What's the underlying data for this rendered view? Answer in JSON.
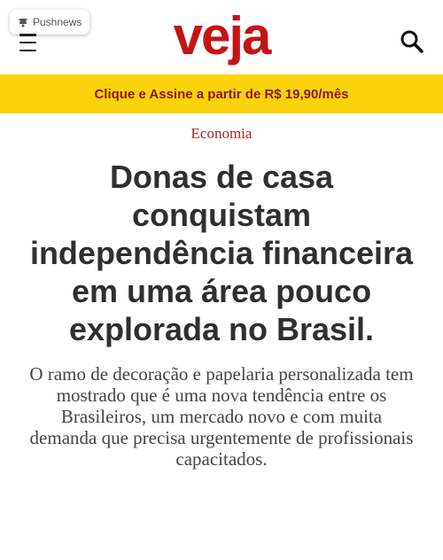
{
  "push_badge": {
    "label": "Pushnews",
    "icon": "bell-icon"
  },
  "header": {
    "logo": "veja",
    "menu_icon": "hamburger-menu-icon",
    "search_icon": "search-icon"
  },
  "promo": {
    "text": "Clique e Assine a partir de R$ 19,90/mês"
  },
  "article": {
    "category": "Economia",
    "headline": "Donas de casa conquistam independência financeira em uma área pouco explorada no Brasil.",
    "subheadline": "O ramo de decoração e papelaria personalizada tem mostrado que é uma nova tendência entre os Brasileiros, um mercado novo e com muita demanda que precisa urgentemente de profissionais capacitados."
  },
  "colors": {
    "brand_red": "#c31515",
    "promo_yellow": "#fcd20d",
    "promo_text": "#8a1a12",
    "category": "#a52a2a"
  }
}
